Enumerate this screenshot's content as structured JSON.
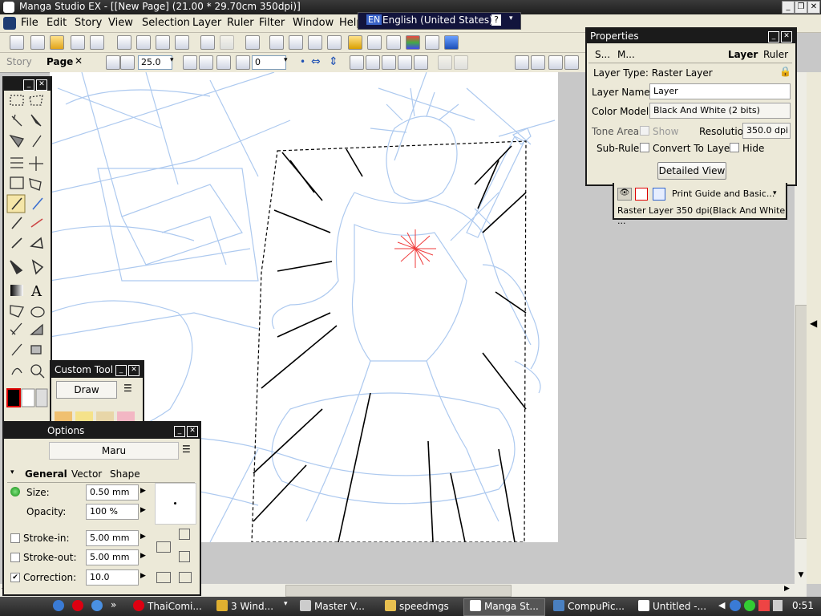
{
  "app": {
    "title": "Manga Studio EX - [[New Page] (21.00 * 29.70cm 350dpi)]",
    "window_buttons": [
      "_",
      "❐",
      "✕"
    ]
  },
  "menubar": {
    "items": [
      "File",
      "Edit",
      "Story",
      "View",
      "Selection",
      "Layer",
      "Ruler",
      "Filter",
      "Window",
      "Help"
    ]
  },
  "language_bar": {
    "code": "EN",
    "label": "English (United States)",
    "help": "?"
  },
  "toolbar2": {
    "tab_story": "Story",
    "tab_page": "Page",
    "zoom": "25.0",
    "rotation": "0"
  },
  "tools_palette": {
    "title": ""
  },
  "custom_tool": {
    "title": "Custom Tool",
    "mode": "Draw"
  },
  "tool_options": {
    "title": "Options",
    "preset": "Maru",
    "tabs": [
      "General",
      "Vector",
      "Shape"
    ],
    "active_tab": "General",
    "size_label": "Size:",
    "size_value": "0.50 mm",
    "opacity_label": "Opacity:",
    "opacity_value": "100 %",
    "stroke_in_label": "Stroke-in:",
    "stroke_in_value": "5.00 mm",
    "stroke_out_label": "Stroke-out:",
    "stroke_out_value": "5.00 mm",
    "correction_label": "Correction:",
    "correction_value": "10.0",
    "correction_checked": true,
    "stroke_in_checked": false,
    "stroke_out_checked": false
  },
  "properties": {
    "title": "Properties",
    "tabs": [
      "S...",
      "M...",
      "Layer",
      "Ruler"
    ],
    "active_tab": "Layer",
    "layer_type": "Layer Type: Raster Layer",
    "layer_name_label": "Layer Name:",
    "layer_name_value": "Layer",
    "color_model_label": "Color Model:",
    "color_model_value": "Black And White (2 bits)",
    "tone_area_label": "Tone Area:",
    "show_label": "Show",
    "resolution_label": "Resolution:",
    "resolution_value": "350.0 dpi",
    "sub_ruler_label": "Sub-Ruler:",
    "convert_label": "Convert To Layer",
    "hide_label": "Hide",
    "detailed_view": "Detailed View"
  },
  "layers": {
    "row1": "Print Guide and Basic...",
    "row2": "Raster Layer 350 dpi(Black And White ..."
  },
  "taskbar": {
    "items": [
      "ThaiComi...",
      "3 Wind...",
      "Master V...",
      "speedmgs",
      "Manga St...",
      "CompuPic...",
      "Untitled -..."
    ],
    "active": "Manga St...",
    "clock": "0:51"
  },
  "colors": {
    "accent": "#316ac5",
    "palette_header": "#1b1b1b",
    "sketch_blue": "#a9c7ef",
    "ui_face": "#ece9d8"
  }
}
